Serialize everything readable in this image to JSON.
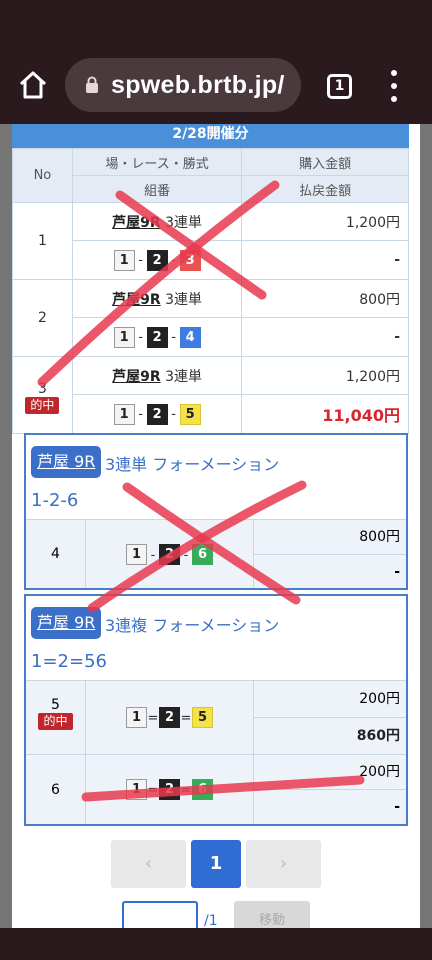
{
  "browser": {
    "url": "spweb.brtb.jp/",
    "tab_count": "1"
  },
  "header": {
    "date_label": "2/28開催分"
  },
  "table_headers": {
    "no": "No",
    "race_type": "場・レース・勝式",
    "combo": "組番",
    "purchase": "購入金額",
    "payout": "払戻金額"
  },
  "rows": [
    {
      "no": "1",
      "race": "芦屋9R",
      "bet": "3連単",
      "nums": [
        "1",
        "2",
        "3"
      ],
      "purchase": "1,200円",
      "payout": "-",
      "hit": ""
    },
    {
      "no": "2",
      "race": "芦屋9R",
      "bet": "3連単",
      "nums": [
        "1",
        "2",
        "4"
      ],
      "purchase": "800円",
      "payout": "-",
      "hit": ""
    },
    {
      "no": "3",
      "race": "芦屋9R",
      "bet": "3連単",
      "nums": [
        "1",
        "2",
        "5"
      ],
      "purchase": "1,200円",
      "payout": "11,040円",
      "hit": "的中"
    }
  ],
  "formations": [
    {
      "race_tag": "芦屋 9R",
      "type": "3連単 フォーメーション",
      "combo": "1-2-6",
      "rows": [
        {
          "no": "4",
          "nums": [
            "1",
            "2",
            "6"
          ],
          "sep": "-",
          "purchase": "800円",
          "payout": "-",
          "hit": ""
        }
      ]
    },
    {
      "race_tag": "芦屋 9R",
      "type": "3連複 フォーメーション",
      "combo": "1=2=56",
      "rows": [
        {
          "no": "5",
          "nums": [
            "1",
            "2",
            "5"
          ],
          "sep": "=",
          "purchase": "200円",
          "payout": "860円",
          "hit": "的中"
        },
        {
          "no": "6",
          "nums": [
            "1",
            "2",
            "6"
          ],
          "sep": "=",
          "purchase": "200円",
          "payout": "-",
          "hit": ""
        }
      ]
    }
  ],
  "pagination": {
    "prev": "‹",
    "current": "1",
    "next": "›",
    "total": "/1",
    "jump_label": "移動"
  },
  "annotation_color": "#e8384f"
}
